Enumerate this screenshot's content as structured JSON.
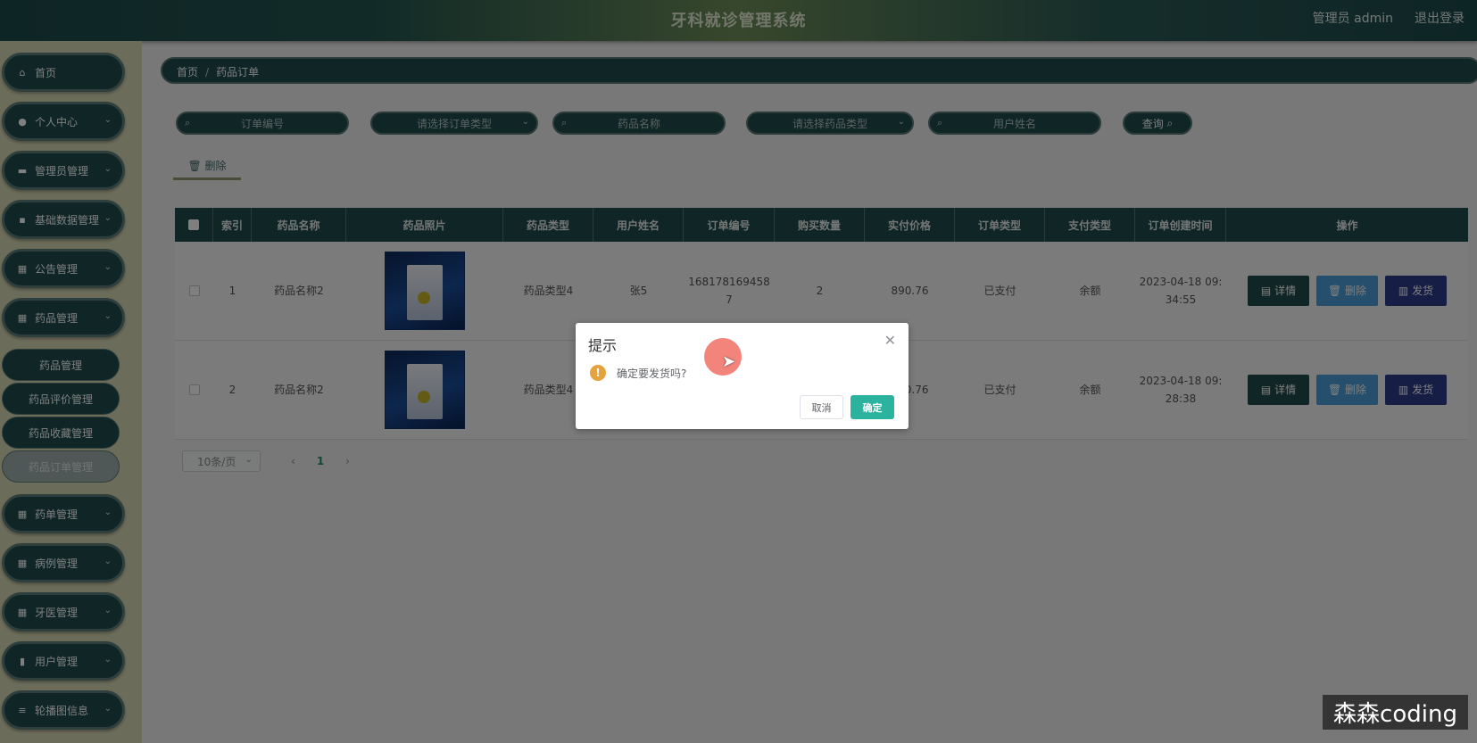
{
  "header": {
    "title": "牙科就诊管理系统",
    "user": "管理员 admin",
    "logout": "退出登录"
  },
  "sidebar": {
    "items": [
      {
        "label": "首页",
        "icon": "home-icon",
        "glyph": "⌂"
      },
      {
        "label": "个人中心",
        "icon": "user-icon",
        "glyph": "●"
      },
      {
        "label": "管理员管理",
        "icon": "monitor-icon",
        "glyph": "▬"
      },
      {
        "label": "基础数据管理",
        "icon": "data-icon",
        "glyph": "▪"
      },
      {
        "label": "公告管理",
        "icon": "grid-icon",
        "glyph": "▦"
      },
      {
        "label": "药品管理",
        "icon": "grid-icon",
        "glyph": "▦"
      },
      {
        "label": "药单管理",
        "icon": "grid-icon",
        "glyph": "▦"
      },
      {
        "label": "病例管理",
        "icon": "grid-icon",
        "glyph": "▦"
      },
      {
        "label": "牙医管理",
        "icon": "grid-icon",
        "glyph": "▦"
      },
      {
        "label": "用户管理",
        "icon": "clipboard-icon",
        "glyph": "▮"
      },
      {
        "label": "轮播图信息",
        "icon": "list-icon",
        "glyph": "≡"
      }
    ],
    "sub_items": [
      "药品管理",
      "药品评价管理",
      "药品收藏管理",
      "药品订单管理"
    ]
  },
  "breadcrumb": {
    "home": "首页",
    "sep": "/",
    "current": "药品订单"
  },
  "search": {
    "order_no_placeholder": "订单编号",
    "order_type_placeholder": "请选择订单类型",
    "drug_name_placeholder": "药品名称",
    "drug_type_placeholder": "请选择药品类型",
    "user_name_placeholder": "用户姓名",
    "query_label": "查询"
  },
  "toolbar": {
    "delete_label": "删除"
  },
  "table": {
    "headers": [
      "索引",
      "药品名称",
      "药品照片",
      "药品类型",
      "用户姓名",
      "订单编号",
      "购买数量",
      "实付价格",
      "订单类型",
      "支付类型",
      "订单创建时间",
      "操作"
    ],
    "rows": [
      {
        "index": "1",
        "name": "药品名称2",
        "type": "药品类型4",
        "user": "张5",
        "order_no": "1681781694587",
        "qty": "2",
        "price": "890.76",
        "order_type": "已支付",
        "pay_type": "余额",
        "created": "2023-04-18 09:34:55"
      },
      {
        "index": "2",
        "name": "药品名称2",
        "type": "药品类型4",
        "user": "",
        "order_no": "",
        "qty": "",
        "price": "890.76",
        "order_type": "已支付",
        "pay_type": "余额",
        "created": "2023-04-18 09:28:38"
      }
    ],
    "actions": {
      "detail": "详情",
      "delete": "删除",
      "ship": "发货"
    }
  },
  "pager": {
    "size": "10条/页",
    "prev": "‹",
    "page": "1",
    "next": "›"
  },
  "dialog": {
    "title": "提示",
    "message": "确定要发货吗?",
    "cancel": "取消",
    "confirm": "确定"
  },
  "watermark": "森森coding",
  "colors": {
    "primary": "#1e4a4c",
    "delete": "#4b9fd8",
    "ship": "#2f3c8c",
    "confirm": "#2bb3a0",
    "warn": "#e6a23c"
  }
}
